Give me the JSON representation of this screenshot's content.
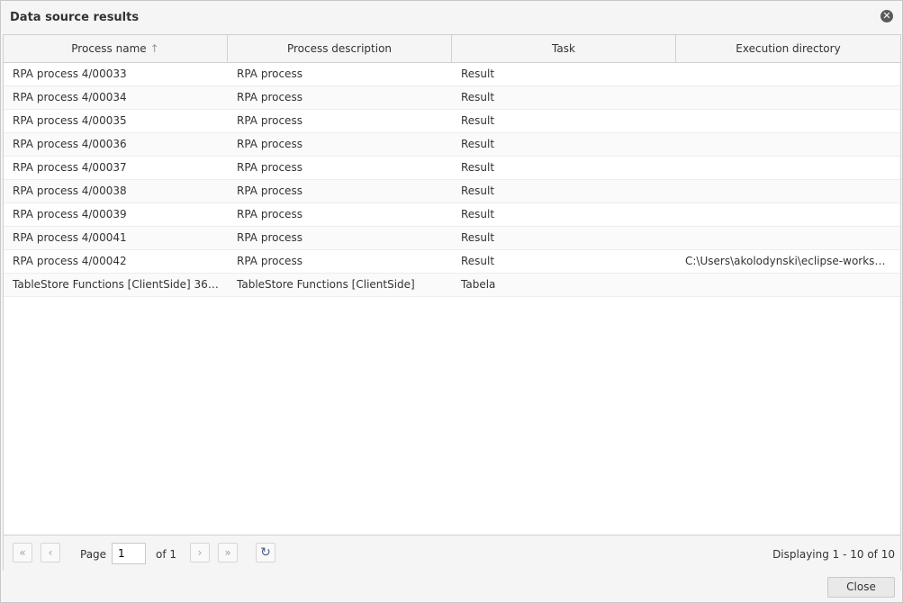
{
  "window": {
    "title": "Data source results"
  },
  "grid": {
    "columns": [
      "Process name",
      "Process description",
      "Task",
      "Execution directory"
    ],
    "rows": [
      [
        "RPA process 4/00033",
        "RPA process",
        "Result",
        ""
      ],
      [
        "RPA process 4/00034",
        "RPA process",
        "Result",
        ""
      ],
      [
        "RPA process 4/00035",
        "RPA process",
        "Result",
        ""
      ],
      [
        "RPA process 4/00036",
        "RPA process",
        "Result",
        ""
      ],
      [
        "RPA process 4/00037",
        "RPA process",
        "Result",
        ""
      ],
      [
        "RPA process 4/00038",
        "RPA process",
        "Result",
        ""
      ],
      [
        "RPA process 4/00039",
        "RPA process",
        "Result",
        ""
      ],
      [
        "RPA process 4/00041",
        "RPA process",
        "Result",
        ""
      ],
      [
        "RPA process 4/00042",
        "RPA process",
        "Result",
        "C:\\Users\\akolodynski\\eclipse-workspa..."
      ],
      [
        "TableStore Functions [ClientSide] 36/...",
        "TableStore Functions [ClientSide]",
        "Tabela",
        ""
      ]
    ]
  },
  "pager": {
    "page_label": "Page",
    "page_value": "1",
    "of_label": "of 1",
    "displaying": "Displaying 1 - 10 of 10"
  },
  "footer": {
    "close_label": "Close"
  },
  "icons": {
    "close": "close-circle-icon",
    "sort": "sort-ascending-icon",
    "first": "first-page-icon",
    "prev": "prev-page-icon",
    "next": "next-page-icon",
    "last": "last-page-icon",
    "refresh": "refresh-icon"
  }
}
